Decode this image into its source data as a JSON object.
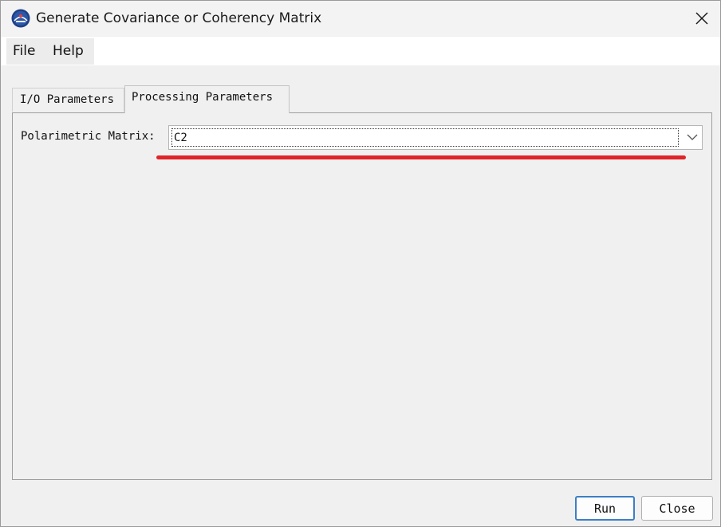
{
  "window": {
    "title": "Generate Covariance or Coherency Matrix",
    "app_icon": "app-logo-icon",
    "close_icon": "close-icon"
  },
  "menu": {
    "items": [
      {
        "label": "File"
      },
      {
        "label": "Help"
      }
    ]
  },
  "tabs": [
    {
      "label": "I/O Parameters",
      "active": false
    },
    {
      "label": "Processing Parameters",
      "active": true
    }
  ],
  "processing": {
    "matrix_label": "Polarimetric Matrix:",
    "matrix_value": "C2",
    "dropdown_icon": "chevron-down-icon"
  },
  "annotation": {
    "color": "#e0242a"
  },
  "buttons": {
    "run": "Run",
    "close": "Close"
  },
  "colors": {
    "primary_button_border": "#3c7fc6",
    "window_bg": "#f0f0f0"
  }
}
